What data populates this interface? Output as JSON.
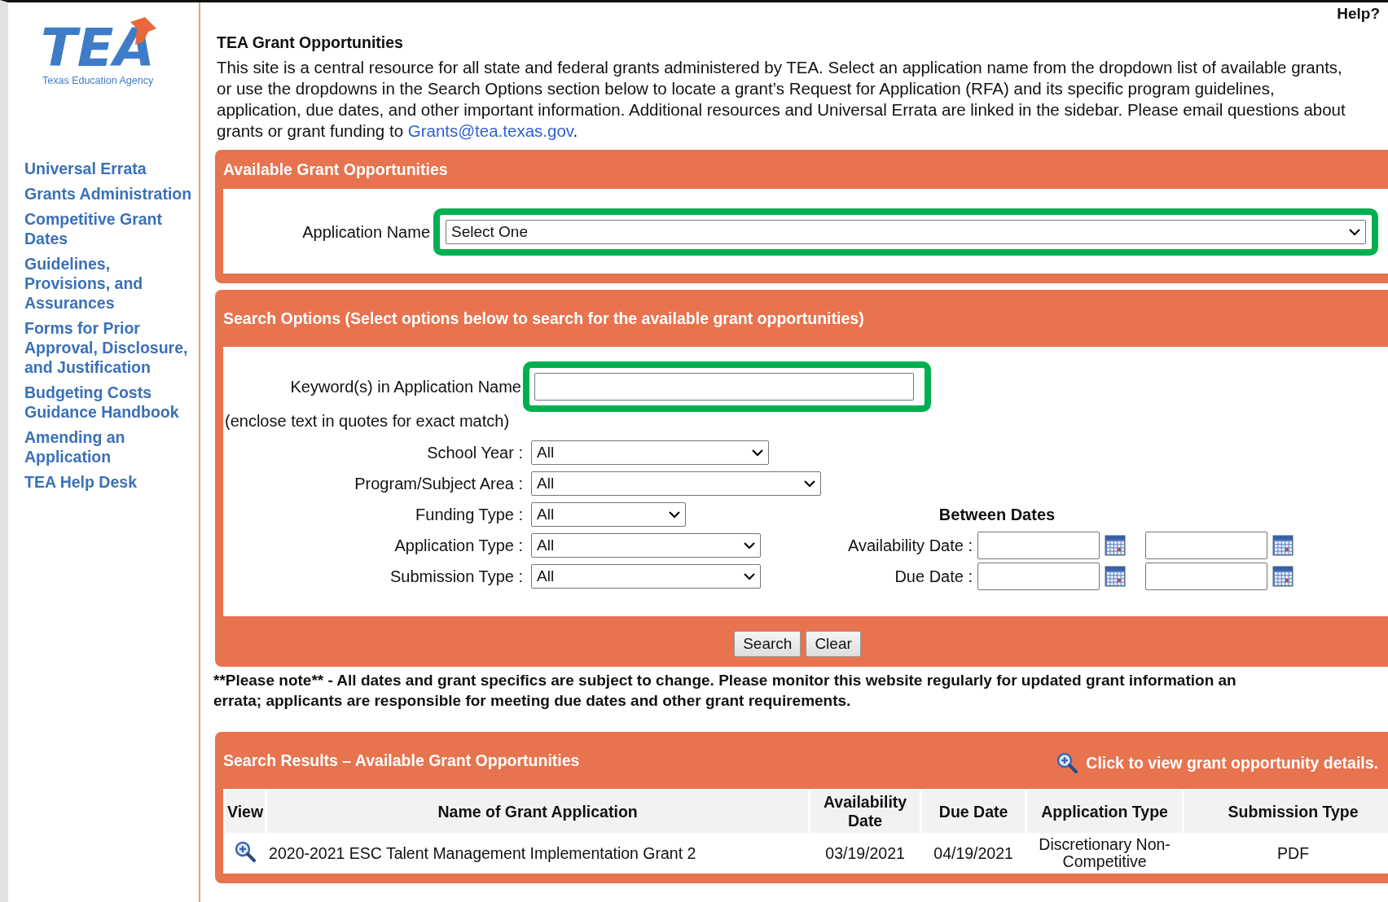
{
  "logo": {
    "name": "TEA",
    "subtitle": "Texas Education Agency"
  },
  "sidebar": {
    "items": [
      "Universal Errata",
      "Grants Administration",
      "Competitive Grant Dates",
      "Guidelines, Provisions, and Assurances",
      "Forms for Prior Approval, Disclosure, and Justification",
      "Budgeting Costs Guidance Handbook",
      "Amending an Application",
      "TEA Help Desk"
    ]
  },
  "help_link": "Help?",
  "title": "TEA Grant Opportunities",
  "intro": {
    "text": "This site is a central resource for all state and federal grants administered by TEA. Select an application name from the dropdown list of available grants, or use the dropdowns in the Search Options section below to locate a grant’s Request for Application (RFA) and its specific program guidelines, application, due dates, and other important information. Additional resources and Universal Errata are linked in the sidebar. Please email questions about grants or grant funding to ",
    "link": "Grants@tea.texas.gov",
    "end": "."
  },
  "available": {
    "title": "Available Grant Opportunities",
    "label": "Application Name",
    "value": "Select One",
    "highlighted": true
  },
  "search": {
    "title": "Search Options (Select options below to search for the available grant opportunities)",
    "keyword": {
      "label": "Keyword(s) in Application Name",
      "hint": "(enclose text in quotes for exact match)",
      "highlighted": true
    },
    "filters": [
      {
        "label": "School Year :",
        "value": "All"
      },
      {
        "label": "Program/Subject Area :",
        "value": "All"
      },
      {
        "label": "Funding Type :",
        "value": "All"
      },
      {
        "label": "Application Type :",
        "value": "All"
      },
      {
        "label": "Submission Type :",
        "value": "All"
      }
    ],
    "dates_title": "Between Dates",
    "dates": [
      {
        "label": "Availability Date :"
      },
      {
        "label": "Due Date :"
      }
    ],
    "buttons": [
      "Search",
      "Clear"
    ]
  },
  "note_lines": [
    "**Please note** - All dates and grant specifics are subject to change. Please monitor this website regularly for updated grant information an",
    "errata; applicants are responsible for meeting due dates and other grant requirements."
  ],
  "results": {
    "title": "Search Results – Available Grant Opportunities",
    "hint": "Click to view grant opportunity details.",
    "columns": [
      "View",
      "Name of Grant Application",
      "Availability Date",
      "Due Date",
      "Application Type",
      "Submission Type"
    ],
    "rows": [
      {
        "name": "2020-2021 ESC Talent Management Implementation Grant 2",
        "availability_date": "03/19/2021",
        "due_date": "04/19/2021",
        "application_type": "Discretionary Non-Competitive",
        "submission_type": "PDF"
      }
    ]
  }
}
